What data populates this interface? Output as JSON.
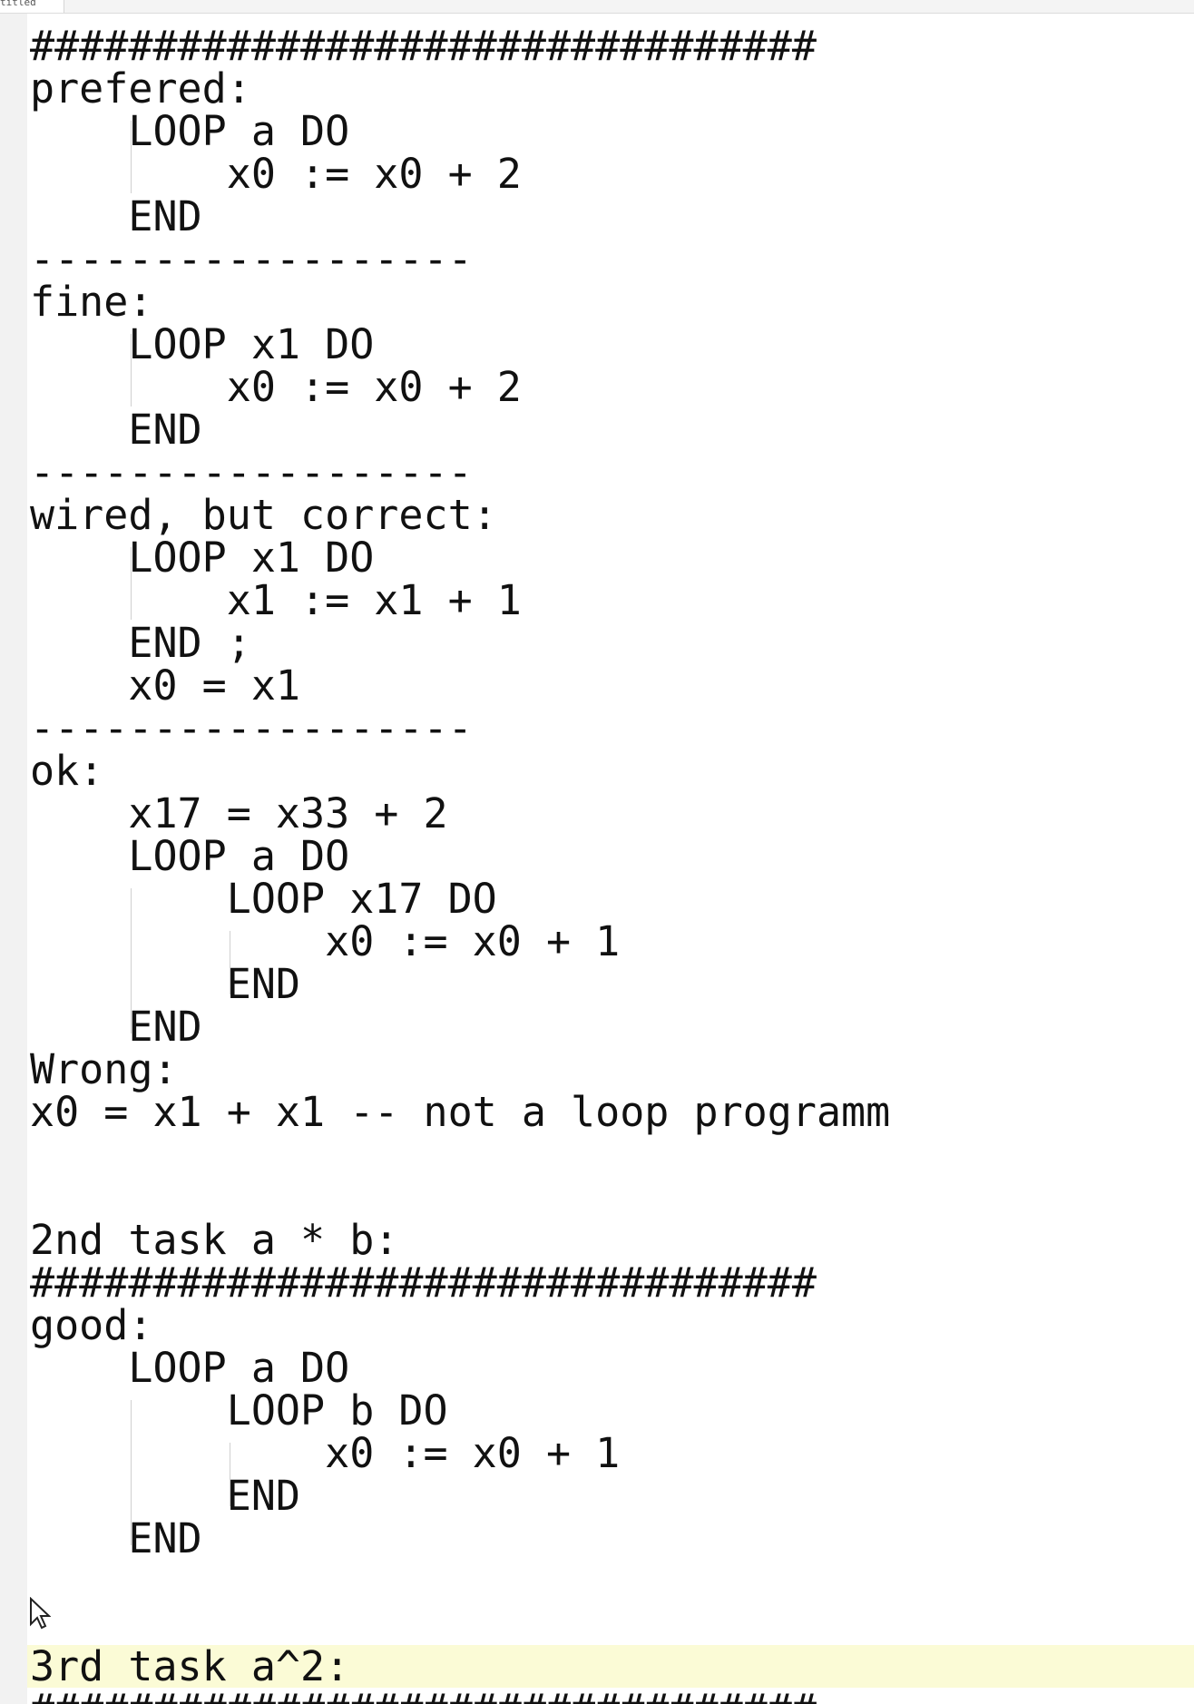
{
  "window": {
    "tab_title": "titled"
  },
  "editor": {
    "lines": [
      "################################",
      "prefered:",
      "    LOOP a DO",
      "        x0 := x0 + 2",
      "    END",
      "------------------",
      "fine:",
      "    LOOP x1 DO",
      "        x0 := x0 + 2",
      "    END",
      "------------------",
      "wired, but correct:",
      "    LOOP x1 DO",
      "        x1 := x1 + 1",
      "    END ;",
      "    x0 = x1",
      "------------------",
      "ok:",
      "    x17 = x33 + 2",
      "    LOOP a DO",
      "        LOOP x17 DO",
      "            x0 := x0 + 1",
      "        END",
      "    END",
      "Wrong:",
      "x0 = x1 + x1 -- not a loop programm",
      "",
      "",
      "2nd task a * b:",
      "################################",
      "good:",
      "    LOOP a DO",
      "        LOOP b DO",
      "            x0 := x0 + 1",
      "        END",
      "    END",
      "",
      "",
      "3rd task a^2:",
      "################################"
    ],
    "current_line": 38
  }
}
